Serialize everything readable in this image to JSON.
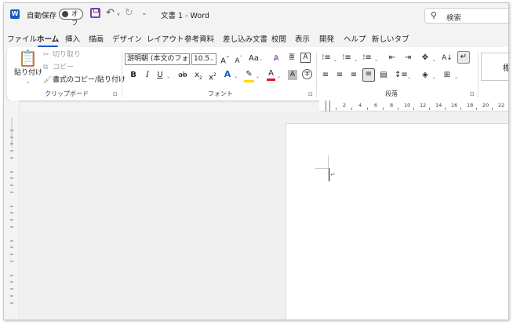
{
  "titlebar": {
    "logo": "W",
    "autosave_label": "自動保存",
    "autosave_state": "オフ",
    "doc_title": "文書 1  -  Word",
    "search_placeholder": "検索"
  },
  "tabs": [
    {
      "label": "ファイル"
    },
    {
      "label": "ホーム",
      "active": true
    },
    {
      "label": "挿入"
    },
    {
      "label": "描画"
    },
    {
      "label": "デザイン"
    },
    {
      "label": "レイアウト"
    },
    {
      "label": "参考資料"
    },
    {
      "label": "差し込み文書"
    },
    {
      "label": "校閲"
    },
    {
      "label": "表示"
    },
    {
      "label": "開発"
    },
    {
      "label": "ヘルプ"
    },
    {
      "label": "新しいタブ"
    }
  ],
  "clipboard": {
    "paste_label": "貼り付け",
    "cut_label": "切り取り",
    "copy_label": "コピー",
    "format_painter_label": "書式のコピー/貼り付け",
    "group_label": "クリップボード"
  },
  "font": {
    "font_name": "游明朝 (本文のフォン",
    "font_size": "10.5",
    "grow": "A",
    "shrink": "A",
    "case": "Aa",
    "bold": "B",
    "italic": "I",
    "underline": "U",
    "strike": "ab",
    "subscript": "x",
    "superscript": "x",
    "group_label": "フォント"
  },
  "paragraph": {
    "group_label": "段落"
  },
  "styles": {
    "first_style": "標"
  },
  "ruler": {
    "labels": [
      "2",
      "4",
      "6",
      "8",
      "10",
      "12",
      "14",
      "16",
      "18",
      "20",
      "22"
    ]
  },
  "colors": {
    "accent": "#185abd",
    "save_icon": "#7b3fa8",
    "highlight": "#ffd700",
    "font_color": "#e81123"
  }
}
